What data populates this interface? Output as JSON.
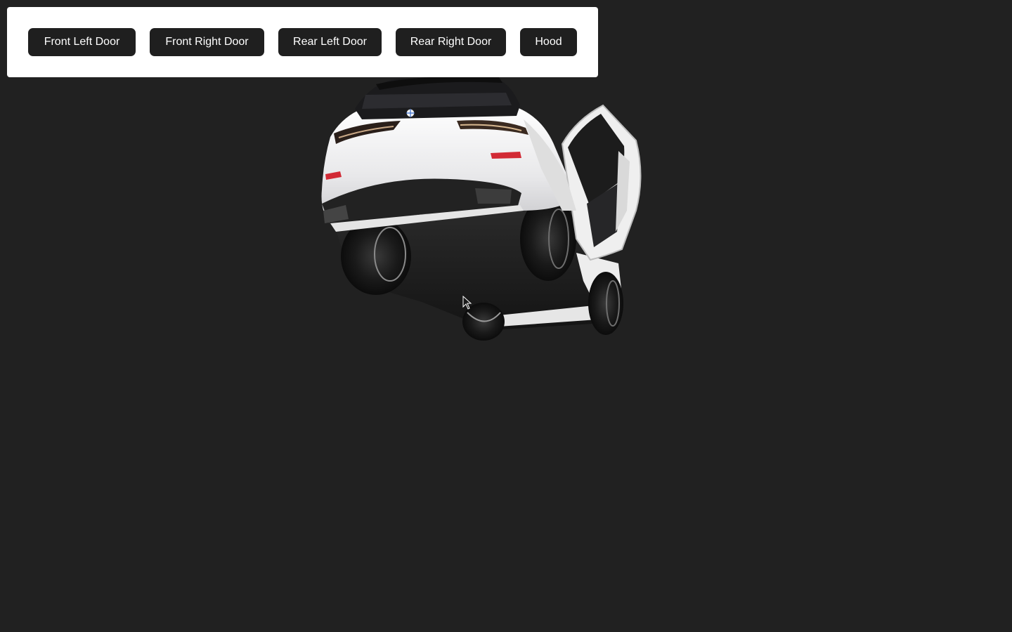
{
  "toolbar": {
    "buttons": [
      {
        "id": "front_left",
        "label": "Front Left Door"
      },
      {
        "id": "front_right",
        "label": "Front Right Door"
      },
      {
        "id": "rear_left",
        "label": "Rear Left Door"
      },
      {
        "id": "rear_right",
        "label": "Rear Right Door"
      },
      {
        "id": "hood",
        "label": "Hood"
      }
    ]
  },
  "scene": {
    "background_color": "#212121",
    "car_color": "#f2f2f2",
    "open_parts": [
      "Rear Right Door"
    ]
  },
  "colors": {
    "toolbar_bg": "#ffffff",
    "button_bg": "#1f1f1f",
    "button_text": "#ffffff"
  }
}
